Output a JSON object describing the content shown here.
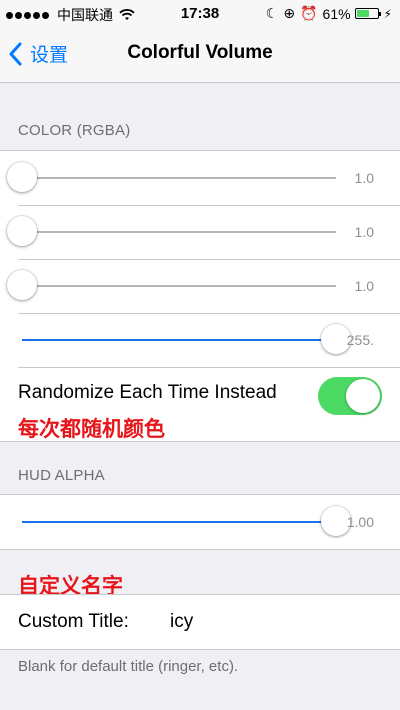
{
  "status_bar": {
    "carrier": "中国联通",
    "time": "17:38",
    "battery": "61%",
    "battery_level": 0.61
  },
  "nav": {
    "back_label": "设置",
    "title": "Colorful Volume"
  },
  "color_section": {
    "header": "COLOR (RGBA)",
    "sliders": [
      {
        "value_label": "1.0",
        "level": 0.0
      },
      {
        "value_label": "1.0",
        "level": 0.0
      },
      {
        "value_label": "1.0",
        "level": 0.0
      },
      {
        "value_label": "255.",
        "level": 1.0
      }
    ],
    "randomize_label": "Randomize Each Time Instead",
    "randomize_on": true
  },
  "annotation_randomize": "每次都随机颜色",
  "hud_section": {
    "header": "HUD ALPHA",
    "slider": {
      "value_label": "1.00",
      "level": 1.0
    }
  },
  "annotation_title": "自定义名字",
  "title_section": {
    "label": "Custom Title:",
    "value": "icy",
    "footer": "Blank for default title (ringer, etc)."
  },
  "colors": {
    "accent": "#007aff",
    "switch_on": "#4cd964",
    "slider_fill": "#1a73e8",
    "annotation": "#e6151a"
  }
}
